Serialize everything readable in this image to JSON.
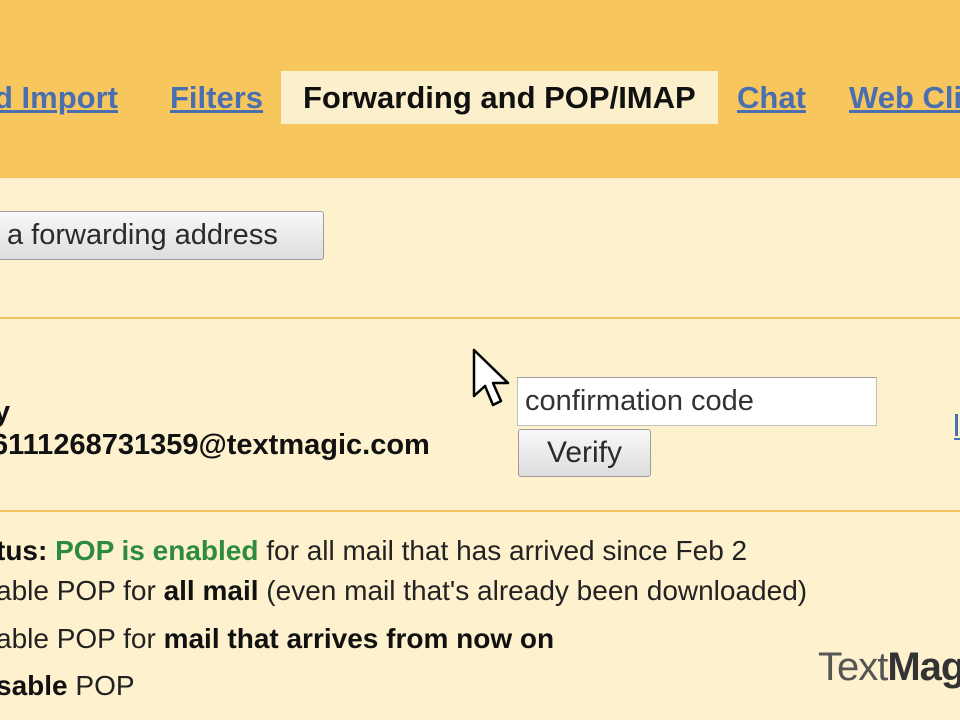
{
  "tabs": {
    "import_label": "d Import",
    "filters_label": "Filters",
    "forwarding_label": "Forwarding and POP/IMAP",
    "chat_label": "Chat",
    "webclips_label": "Web Cli"
  },
  "forwarding": {
    "add_button_label": "a forwarding address",
    "label_fragment": "y",
    "address": "6111268731359@textmagic.com",
    "code_placeholder": "confirmation code",
    "verify_label": "Verify"
  },
  "pop": {
    "status_prefix": "tus: ",
    "status_value": "POP is enabled",
    "status_suffix": " for all mail that has arrived since Feb 2",
    "option1_prefix": "able POP for ",
    "option1_bold": "all mail",
    "option1_suffix": " (even mail that's already been downloaded)",
    "option2_prefix": "able POP for ",
    "option2_bold": "mail that arrives from now on",
    "option3_bold": "sable",
    "option3_suffix": " POP"
  },
  "watermark": {
    "part1": "Text",
    "part2": "Magi"
  },
  "colors": {
    "tabbar_bg": "#F7C75E",
    "content_bg": "#FDF1CE",
    "link_blue": "#4A6FB0",
    "status_green": "#2E8B3E"
  },
  "icons": {
    "cursor": "mouse-pointer-icon"
  }
}
